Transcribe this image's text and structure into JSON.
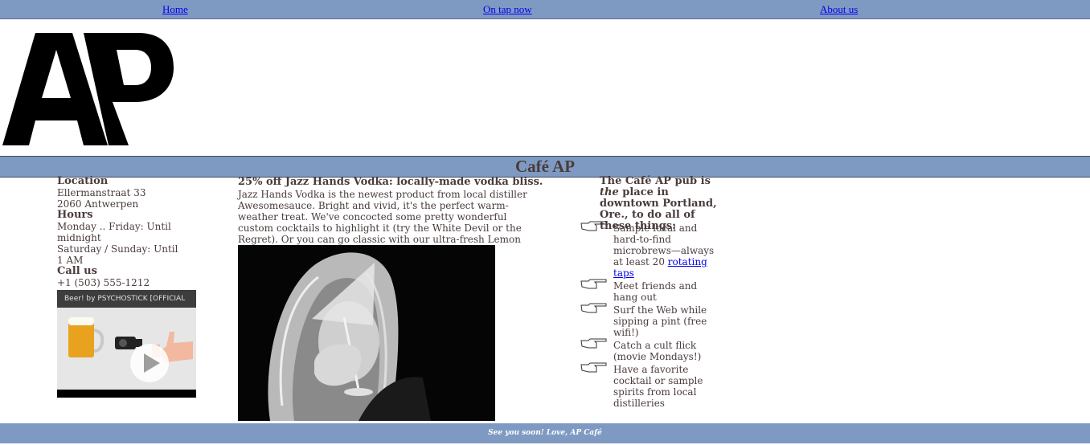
{
  "nav": {
    "home": "Home",
    "on_tap": "On tap now",
    "about": "About us"
  },
  "logo": {
    "text": "AP"
  },
  "site_title": "Café AP",
  "left": {
    "location_heading": "Location",
    "address_line1": "Ellermanstraat 33",
    "address_line2": "2060 Antwerpen",
    "hours_heading": "Hours",
    "hours_weekday": "Monday .. Friday: Until midnight",
    "hours_weekend": "Saturday / Sunday: Until 1 AM",
    "call_heading": "Call us",
    "phone": "+1 (503) 555-1212",
    "video_title": "Beer! by PSYCHOSTICK [OFFICIAL"
  },
  "promo": {
    "heading": "25% off Jazz Hands Vodka: locally-made vodka bliss.",
    "body": "Jazz Hands Vodka is the newest product from local distiller Awesomesauce. Bright and vivid, it's the perfect warm-weather treat. We've concocted some pretty wonderful custom cocktails to highlight it (try the White Devil or the Regret). Or you can go classic with our ultra-fresh Lemon Drop (made with organic citrus)."
  },
  "pub": {
    "intro_before": "The Café AP pub is ",
    "intro_em": "the",
    "intro_after": " place in downtown Portland, Ore., to do all of these things:",
    "items": [
      {
        "text": "Sample local and hard-to-find microbrews—always at least 20 ",
        "link": "rotating taps"
      },
      {
        "text": "Meet friends and hang out"
      },
      {
        "text": "Surf the Web while sipping a pint (free wifi!)"
      },
      {
        "text": "Catch a cult flick (movie Mondays!)"
      },
      {
        "text": "Have a favorite cocktail or sample spirits from local distilleries"
      }
    ]
  },
  "footer": "See you soon! Love, AP Café",
  "colors": {
    "band": "#7f9ac2",
    "text": "#4a3b3b",
    "link": "#0000ee"
  }
}
